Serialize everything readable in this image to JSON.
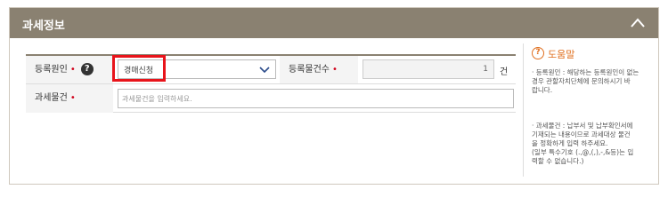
{
  "panel": {
    "title": "과세정보",
    "collapse_icon": "chevron-up-icon"
  },
  "form": {
    "registration_reason": {
      "label": "등록원인",
      "required_mark": "•",
      "help_icon": "?",
      "selected_value": "경매신청"
    },
    "item_count": {
      "label": "등록물건수",
      "required_mark": "•",
      "value": "1",
      "unit": "건"
    },
    "taxable_item": {
      "label": "과세물건",
      "required_mark": "•",
      "placeholder": "과세물건을 입력하세요."
    }
  },
  "help": {
    "icon": "?",
    "title": "도움말",
    "text1": "· 등록원인 : 해당하는 등록원인이 없는\n경우 관할자치단체에 문의하시기 바\n랍니다.",
    "text2": "· 과세물건 : 납부서 및 납부확인서에\n기재되는 내용이므로 과세대상 물건\n을 정확하게 입력 하주세요.\n(일부 특수기호 (.,@,(,),-,&등)는 입\n력할 수 없습니다.)"
  },
  "colors": {
    "header_bg": "#8a8171",
    "required": "#d0021b",
    "highlight": "#e8141b",
    "help_accent": "#e07020"
  }
}
